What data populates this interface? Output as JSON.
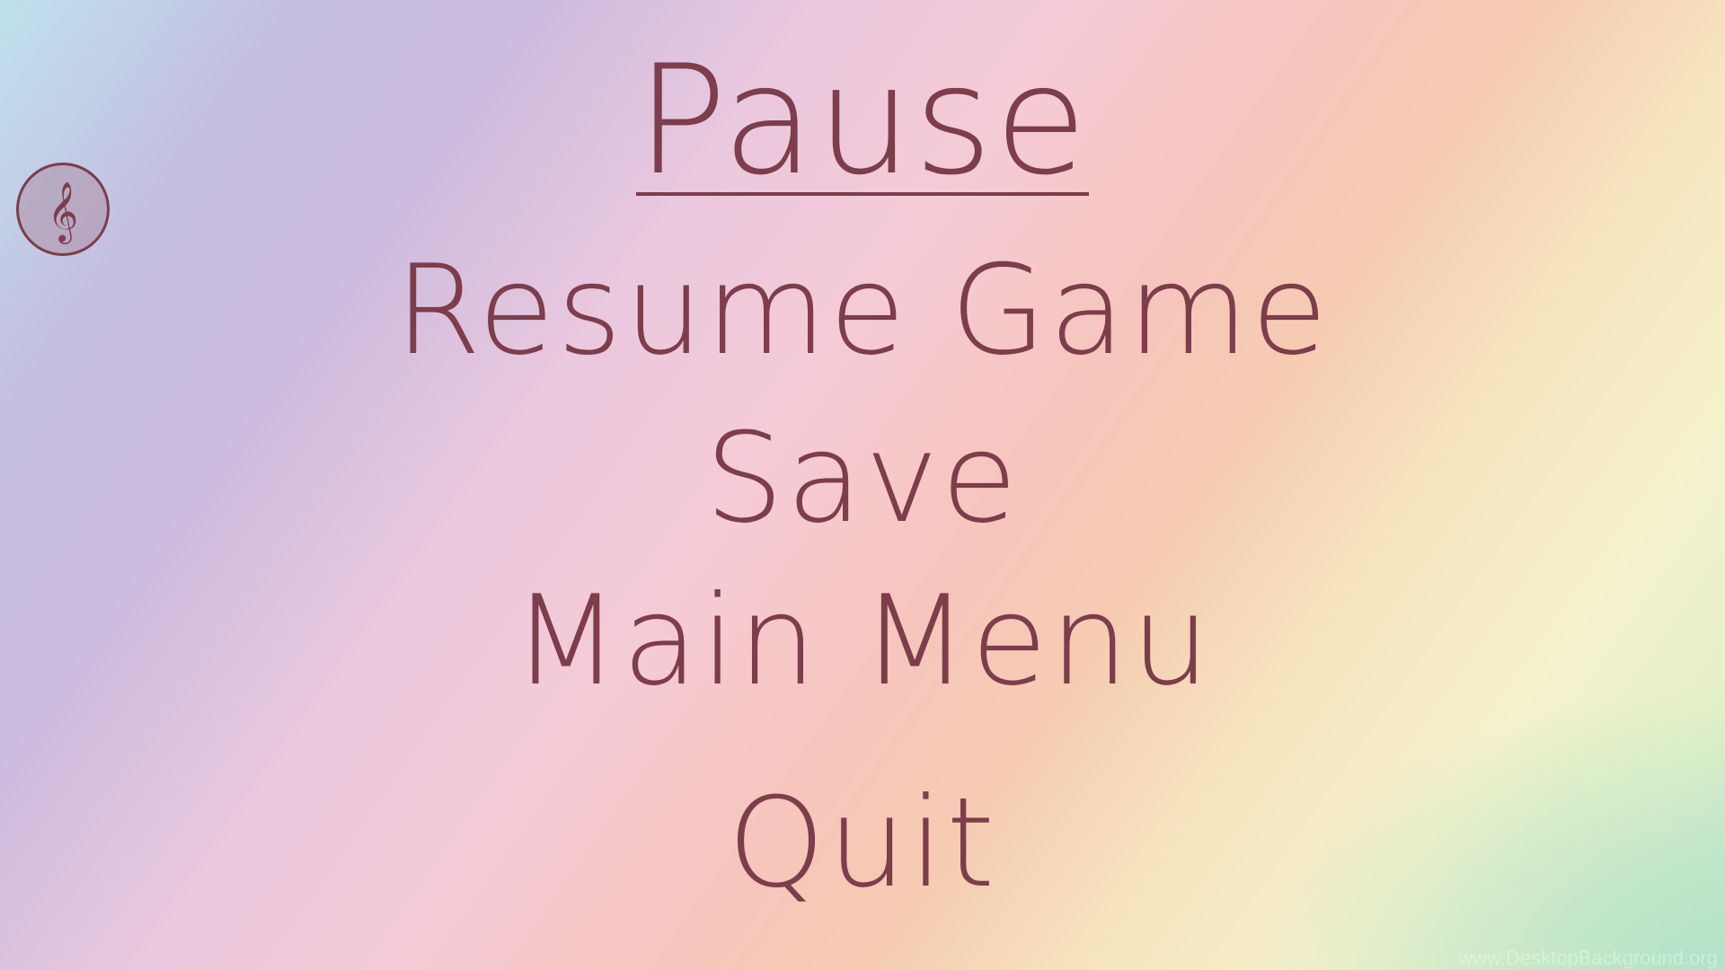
{
  "pause_menu": {
    "title": "Pause",
    "items": [
      {
        "label": "Resume Game"
      },
      {
        "label": "Save"
      },
      {
        "label": "Main Menu"
      },
      {
        "label": "Quit"
      }
    ]
  },
  "music_button": {
    "icon": "treble-clef-icon",
    "glyph": "𝄞"
  },
  "watermark": {
    "text": "www.DesktopBackground.org"
  },
  "colors": {
    "text": "#7d3d4b"
  }
}
